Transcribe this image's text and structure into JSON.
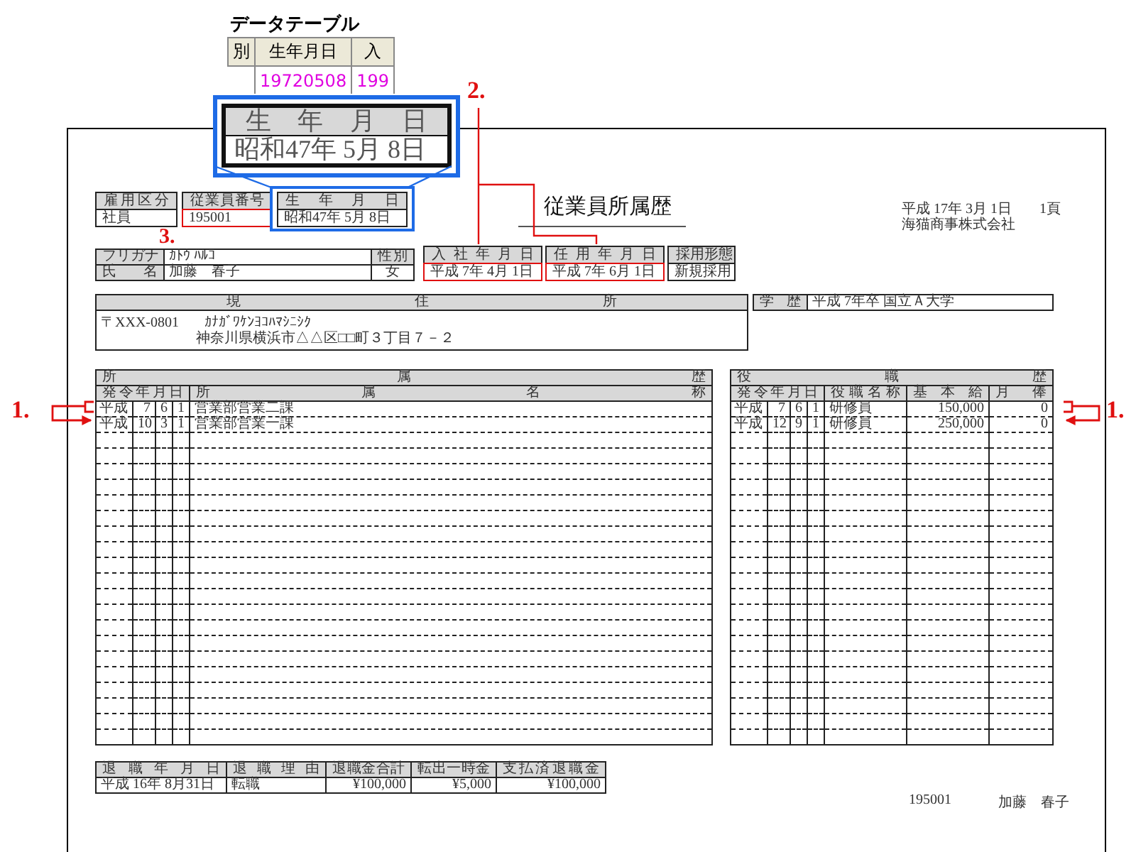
{
  "data_table": {
    "title": "データテーブル",
    "columns": [
      "別",
      "生年月日",
      "入"
    ],
    "rows": [
      {
        "birth_date": "19720508",
        "column_3": "199"
      }
    ]
  },
  "zoom_callout": {
    "label": "生年月日",
    "value": "昭和47年 5月 8日"
  },
  "report": {
    "title": "従業員所属歴",
    "date": "平成 17年 3月 1日",
    "page": "1頁",
    "company": "海猫商事株式会社",
    "employment_type": {
      "label": "雇用区分",
      "value": "社員"
    },
    "employee_no": {
      "label": "従業員番号",
      "value": "195001",
      "highlighted": true
    },
    "birth_date": {
      "label": "生年月日",
      "value": "昭和47年 5月 8日"
    },
    "furigana": {
      "label": "フリガナ",
      "value": "ｶﾄｳ ﾊﾙｺ"
    },
    "name": {
      "label": "氏名",
      "value": "加藤　春子"
    },
    "gender": {
      "label": "性別",
      "value": "女"
    },
    "hire_date": {
      "label": "入社年月日",
      "value": "平成 7年 4月 1日",
      "highlighted": true
    },
    "appointment_date": {
      "label": "任用年月日",
      "value": "平成 7年 6月 1日",
      "highlighted": true
    },
    "hiring_form": {
      "label": "採用形態",
      "value": "新規採用"
    },
    "address": {
      "label": "現住所",
      "postal": "〒XXX-0801",
      "kana": "ｶﾅｶﾞﾜｹﾝﾖｺﾊﾏｼﾆｼｸ",
      "value": "神奈川県横浜市△△区□□町３丁目７－２"
    },
    "education": {
      "label": "学歴",
      "value": "平成 7年卒 国立Ａ大学"
    },
    "department_history": {
      "title": "所属歴",
      "date_header": "発令年月日",
      "name_header": "所属名称",
      "rows": [
        {
          "era": "平成",
          "year": "7",
          "month": "6",
          "day": "1",
          "department": "営業部営業二課"
        },
        {
          "era": "平成",
          "year": "10",
          "month": "3",
          "day": "1",
          "department": "営業部営業一課"
        }
      ]
    },
    "position_history": {
      "title": "役職歴",
      "date_header": "発令年月日",
      "columns": [
        "役職名称",
        "基本給",
        "月俸"
      ],
      "rows": [
        {
          "era": "平成",
          "year": "7",
          "month": "6",
          "day": "1",
          "position": "研修員",
          "base_salary": "150,000",
          "monthly": "0"
        },
        {
          "era": "平成",
          "year": "12",
          "month": "9",
          "day": "1",
          "position": "研修員",
          "base_salary": "250,000",
          "monthly": "0"
        }
      ]
    },
    "retirement": {
      "columns": [
        "退職年月日",
        "退職理由",
        "退職金合計",
        "転出一時金",
        "支払済退職金"
      ],
      "values": [
        "平成 16年 8月31日",
        "転職",
        "¥100,000",
        "¥5,000",
        "¥100,000"
      ]
    },
    "footer": {
      "employee_no": "195001",
      "name": "加藤　春子"
    }
  },
  "annotations": [
    "1.",
    "1.",
    "2.",
    "3."
  ]
}
